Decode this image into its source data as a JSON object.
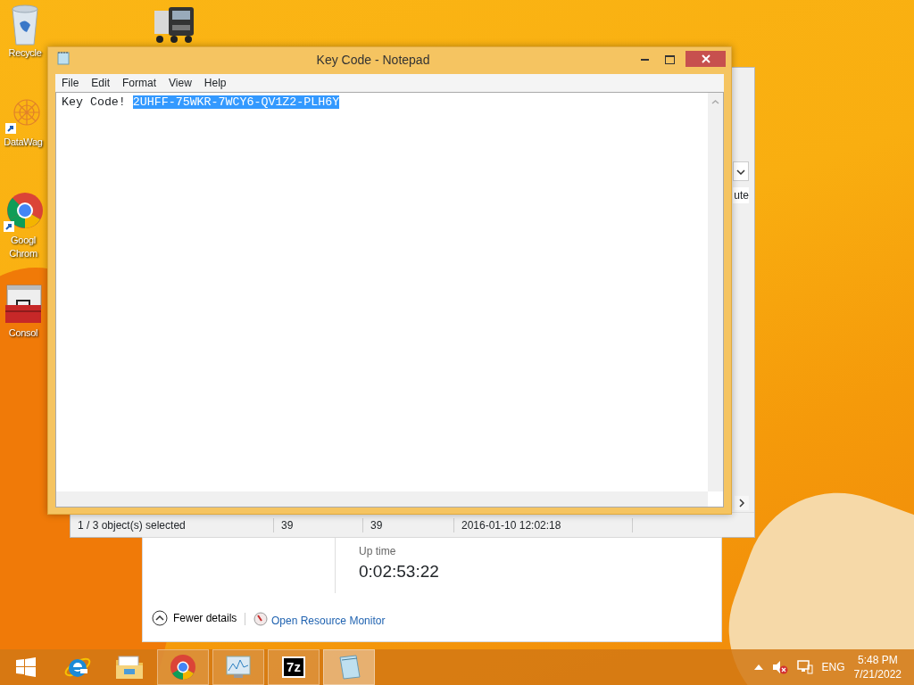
{
  "desktop_icons": [
    {
      "kind": "recycle",
      "lines": [
        "Recycle"
      ]
    },
    {
      "kind": "truck"
    },
    {
      "kind": "datawag",
      "lines": [
        "DataWag"
      ]
    },
    {
      "kind": "chrome",
      "lines": [
        "Googl",
        "Chrom"
      ]
    },
    {
      "kind": "toolbox",
      "lines": [
        "Consol"
      ]
    }
  ],
  "explorer_window": {
    "column_header": "ute",
    "status_bar": [
      "1 / 3 object(s) selected",
      "39",
      "39",
      "2016-01-10 12:02:18"
    ]
  },
  "task_manager": {
    "uptime_label": "Up time",
    "uptime_value": "0:02:53:22",
    "fewer_details": "Fewer details",
    "resource_monitor_link": "Open Resource Monitor"
  },
  "notepad": {
    "title": "Key Code - Notepad",
    "menu": [
      "File",
      "Edit",
      "Format",
      "View",
      "Help"
    ],
    "text": "Key Code! ",
    "selected_text": "2UHFF-75WKR-7WCY6-QV1Z2-PLH6Y"
  },
  "taskbar": {
    "items": [
      {
        "kind": "start",
        "running": false,
        "active": false
      },
      {
        "kind": "ie",
        "running": false,
        "active": false
      },
      {
        "kind": "explorer",
        "running": false,
        "active": false
      },
      {
        "kind": "chrome",
        "running": true,
        "active": false
      },
      {
        "kind": "resmon",
        "running": true,
        "active": false
      },
      {
        "kind": "sevenzip",
        "running": true,
        "active": false,
        "label": "7z"
      },
      {
        "kind": "notepad",
        "running": true,
        "active": true
      }
    ],
    "language": "ENG",
    "time": "5:48 PM",
    "date": "7/21/2022"
  }
}
